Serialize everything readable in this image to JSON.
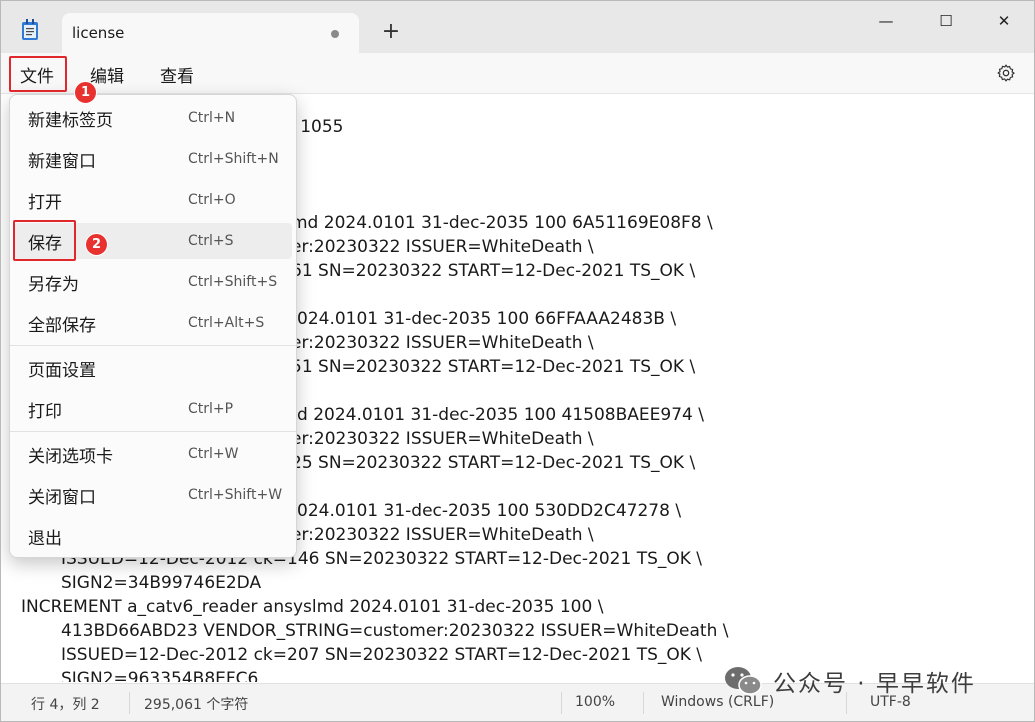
{
  "tab": {
    "title": "license"
  },
  "window_controls": {
    "minimize": "—",
    "maximize": "☐",
    "close": "✕"
  },
  "menubar": {
    "items": [
      "文件",
      "编辑",
      "查看"
    ]
  },
  "editor": {
    "lines": [
      "d 1055",
      "md 2024.0101 31-dec-2035 100 6A51169E08F8 \\",
      "er:20230322 ISSUER=WhiteDeath \\",
      "61 SN=20230322 START=12-Dec-2021 TS_OK \\",
      "024.0101 31-dec-2035 100 66FFAAA2483B \\",
      "er:20230322 ISSUER=WhiteDeath \\",
      "51 SN=20230322 START=12-Dec-2021 TS_OK \\",
      "d 2024.0101 31-dec-2035 100 41508BAEE974 \\",
      "er:20230322 ISSUER=WhiteDeath \\",
      "25 SN=20230322 START=12-Dec-2021 TS_OK \\",
      "024.0101 31-dec-2035 100 530DD2C47278 \\",
      "er:20230322 ISSUER=WhiteDeath \\",
      "ISSUED=12-Dec-2012 ck=146 SN=20230322 START=12-Dec-2021 TS_OK \\",
      "SIGN2=34B99746E2DA",
      "INCREMENT a_catv6_reader ansyslmd 2024.0101 31-dec-2035 100 \\",
      "413BD66ABD23 VENDOR_STRING=customer:20230322 ISSUER=WhiteDeath \\",
      "ISSUED=12-Dec-2012 ck=207 SN=20230322 START=12-Dec-2021 TS_OK \\",
      "SIGN2=963354B8EFC6"
    ]
  },
  "file_menu": {
    "items": [
      {
        "label": "新建标签页",
        "shortcut": "Ctrl+N"
      },
      {
        "label": "新建窗口",
        "shortcut": "Ctrl+Shift+N"
      },
      {
        "label": "打开",
        "shortcut": "Ctrl+O"
      },
      {
        "label": "保存",
        "shortcut": "Ctrl+S"
      },
      {
        "label": "另存为",
        "shortcut": "Ctrl+Shift+S"
      },
      {
        "label": "全部保存",
        "shortcut": "Ctrl+Alt+S"
      },
      {
        "label": "页面设置",
        "shortcut": ""
      },
      {
        "label": "打印",
        "shortcut": "Ctrl+P"
      },
      {
        "label": "关闭选项卡",
        "shortcut": "Ctrl+W"
      },
      {
        "label": "关闭窗口",
        "shortcut": "Ctrl+Shift+W"
      },
      {
        "label": "退出",
        "shortcut": ""
      }
    ]
  },
  "annotations": {
    "badge1": "1",
    "badge2": "2"
  },
  "statusbar": {
    "position": "行 4，列 2",
    "chars": "295,061 个字符",
    "zoom": "100%",
    "line_ending": "Windows (CRLF)",
    "encoding": "UTF-8"
  },
  "watermark": {
    "text": "公众号 · 早早软件"
  },
  "colors": {
    "annotation_red": "#e0272b",
    "titlebar": "#e8e8e8",
    "menu_bg": "#fbfbfb"
  }
}
